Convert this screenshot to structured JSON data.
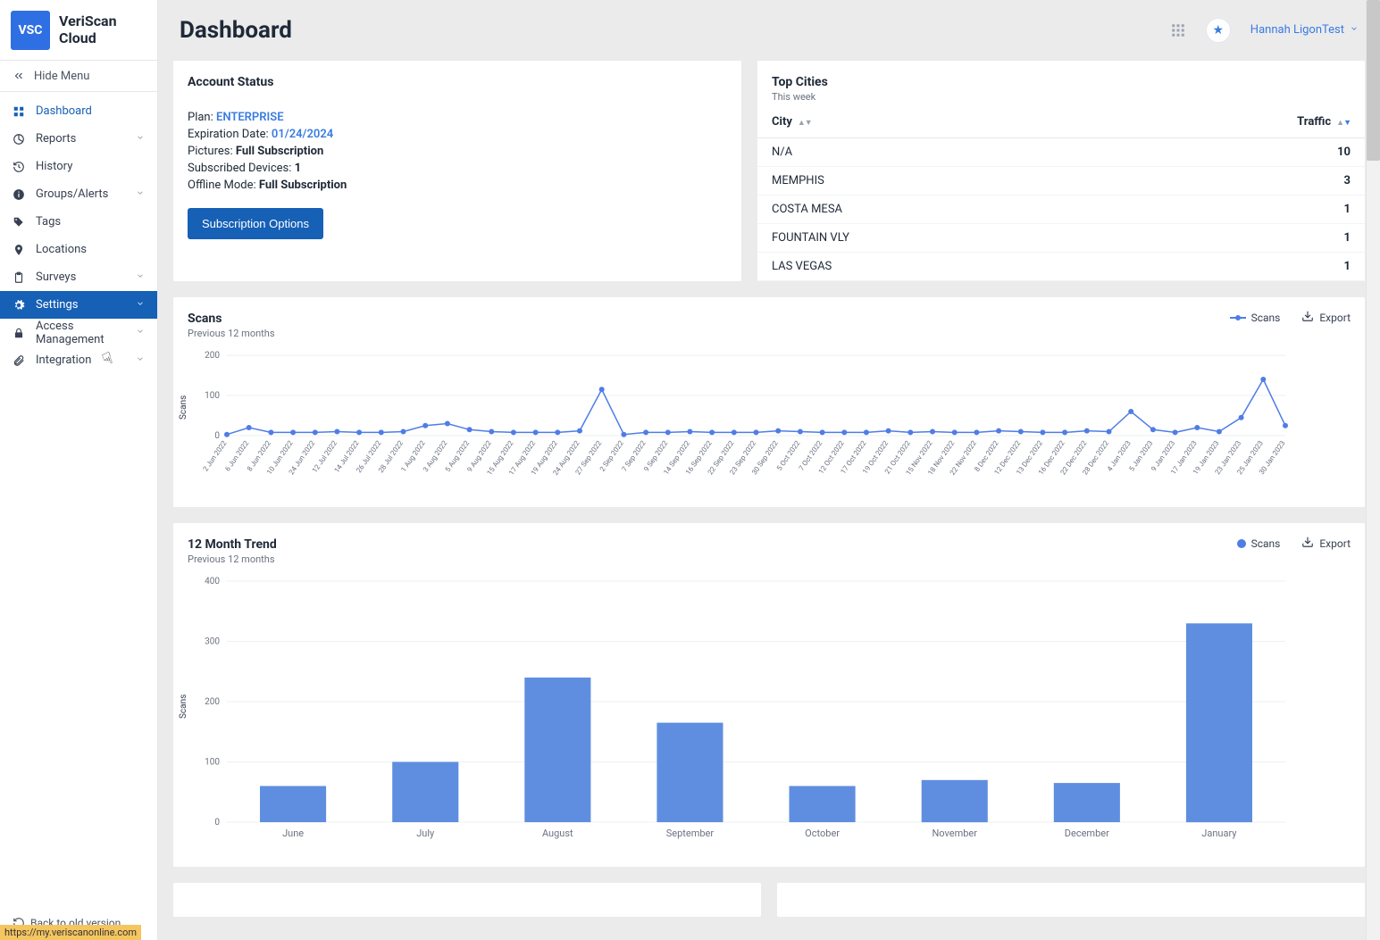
{
  "brand": {
    "name_line1": "VeriScan",
    "name_line2": "Cloud",
    "badge": "VSC"
  },
  "hide_menu": "Hide Menu",
  "nav": {
    "items": [
      {
        "icon": "grid",
        "label": "Dashboard",
        "active_blue": true
      },
      {
        "icon": "chart",
        "label": "Reports",
        "chev": true
      },
      {
        "icon": "history",
        "label": "History"
      },
      {
        "icon": "info",
        "label": "Groups/Alerts",
        "chev": true
      },
      {
        "icon": "tag",
        "label": "Tags"
      },
      {
        "icon": "pin",
        "label": "Locations"
      },
      {
        "icon": "clipboard",
        "label": "Surveys",
        "chev": true
      },
      {
        "icon": "gear",
        "label": "Settings",
        "selected": true,
        "chev": true
      },
      {
        "icon": "lock",
        "label": "Access Management",
        "chev": true
      },
      {
        "icon": "clip",
        "label": "Integration",
        "chev": true
      }
    ]
  },
  "header": {
    "title": "Dashboard",
    "user": "Hannah LigonTest"
  },
  "account": {
    "title": "Account Status",
    "plan_label": "Plan: ",
    "plan_value": "ENTERPRISE",
    "exp_label": "Expiration Date: ",
    "exp_value": "01/24/2024",
    "pic_label": "Pictures: ",
    "pic_value": "Full Subscription",
    "dev_label": "Subscribed Devices: ",
    "dev_value": "1",
    "off_label": "Offline Mode: ",
    "off_value": "Full Subscription",
    "button": "Subscription Options"
  },
  "cities": {
    "title": "Top Cities",
    "subtitle": "This week",
    "col_city": "City",
    "col_traffic": "Traffic",
    "rows": [
      {
        "city": "N/A",
        "traffic": "10"
      },
      {
        "city": "MEMPHIS",
        "traffic": "3"
      },
      {
        "city": "COSTA MESA",
        "traffic": "1"
      },
      {
        "city": "FOUNTAIN VLY",
        "traffic": "1"
      },
      {
        "city": "LAS VEGAS",
        "traffic": "1"
      }
    ]
  },
  "scans": {
    "title": "Scans",
    "subtitle": "Previous 12 months",
    "legend": "Scans",
    "export": "Export",
    "ylab": "Scans"
  },
  "trend": {
    "title": "12 Month Trend",
    "subtitle": "Previous 12 months",
    "legend": "Scans",
    "export": "Export",
    "ylab": "Scans"
  },
  "footer": {
    "back": "Back to old version",
    "url": "https://my.veriscanonline.com"
  },
  "chart_data": [
    {
      "type": "line",
      "id": "scans",
      "title": "Scans",
      "xlabel": "",
      "ylabel": "Scans",
      "ylim": [
        0,
        200
      ],
      "yticks": [
        0,
        100,
        200
      ],
      "categories": [
        "2 Jun 2022",
        "6 Jun 2022",
        "8 Jun 2022",
        "10 Jun 2022",
        "24 Jun 2022",
        "12 Jul 2022",
        "14 Jul 2022",
        "26 Jul 2022",
        "28 Jul 2022",
        "1 Aug 2022",
        "3 Aug 2022",
        "5 Aug 2022",
        "9 Aug 2022",
        "15 Aug 2022",
        "17 Aug 2022",
        "19 Aug 2022",
        "24 Aug 2022",
        "27 Sep 2022",
        "2 Sep 2022",
        "7 Sep 2022",
        "9 Sep 2022",
        "14 Sep 2022",
        "16 Sep 2022",
        "22 Sep 2022",
        "23 Sep 2022",
        "30 Sep 2022",
        "5 Oct 2022",
        "7 Oct 2022",
        "12 Oct 2022",
        "17 Oct 2022",
        "19 Oct 2022",
        "21 Oct 2022",
        "15 Nov 2022",
        "18 Nov 2022",
        "22 Nov 2022",
        "8 Dec 2022",
        "12 Dec 2022",
        "13 Dec 2022",
        "16 Dec 2022",
        "22 Dec 2022",
        "28 Dec 2022",
        "4 Jan 2023",
        "5 Jan 2023",
        "9 Jan 2023",
        "17 Jan 2023",
        "19 Jan 2023",
        "23 Jan 2023",
        "25 Jan 2023",
        "30 Jan 2023"
      ],
      "values": [
        3,
        20,
        8,
        8,
        8,
        10,
        8,
        8,
        10,
        25,
        30,
        15,
        10,
        8,
        8,
        8,
        12,
        115,
        3,
        8,
        8,
        10,
        8,
        8,
        8,
        12,
        10,
        8,
        8,
        8,
        12,
        8,
        10,
        8,
        8,
        12,
        10,
        8,
        8,
        12,
        10,
        60,
        15,
        8,
        20,
        10,
        45,
        140,
        25
      ]
    },
    {
      "type": "bar",
      "id": "trend",
      "title": "12 Month Trend",
      "xlabel": "",
      "ylabel": "Scans",
      "ylim": [
        0,
        400
      ],
      "yticks": [
        0,
        100,
        200,
        300,
        400
      ],
      "categories": [
        "June",
        "July",
        "August",
        "September",
        "October",
        "November",
        "December",
        "January"
      ],
      "values": [
        60,
        100,
        240,
        165,
        60,
        70,
        65,
        330
      ]
    }
  ]
}
